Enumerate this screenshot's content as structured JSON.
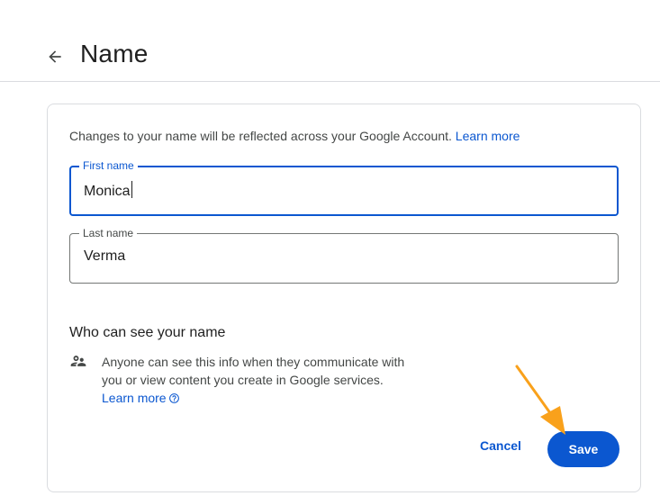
{
  "header": {
    "title": "Name",
    "back_icon": "arrow-back-icon"
  },
  "card": {
    "intro_text": "Changes to your name will be reflected across your Google Account.",
    "intro_link": "Learn more",
    "first_name": {
      "label": "First name",
      "value": "Monica"
    },
    "last_name": {
      "label": "Last name",
      "value": "Verma"
    },
    "visibility": {
      "title": "Who can see your name",
      "icon": "people-icon",
      "description": "Anyone can see this info when they communicate with you or view content you create in Google services.",
      "link": "Learn more",
      "link_icon": "help-circle-icon"
    },
    "actions": {
      "cancel_label": "Cancel",
      "save_label": "Save"
    }
  },
  "annotation": {
    "arrow_color": "#f9a11b",
    "arrow_icon": "pointer-arrow-icon"
  },
  "colors": {
    "accent": "#0b57d0",
    "text": "#1f1f1f",
    "secondary_text": "#444746",
    "border": "#dadce0"
  }
}
